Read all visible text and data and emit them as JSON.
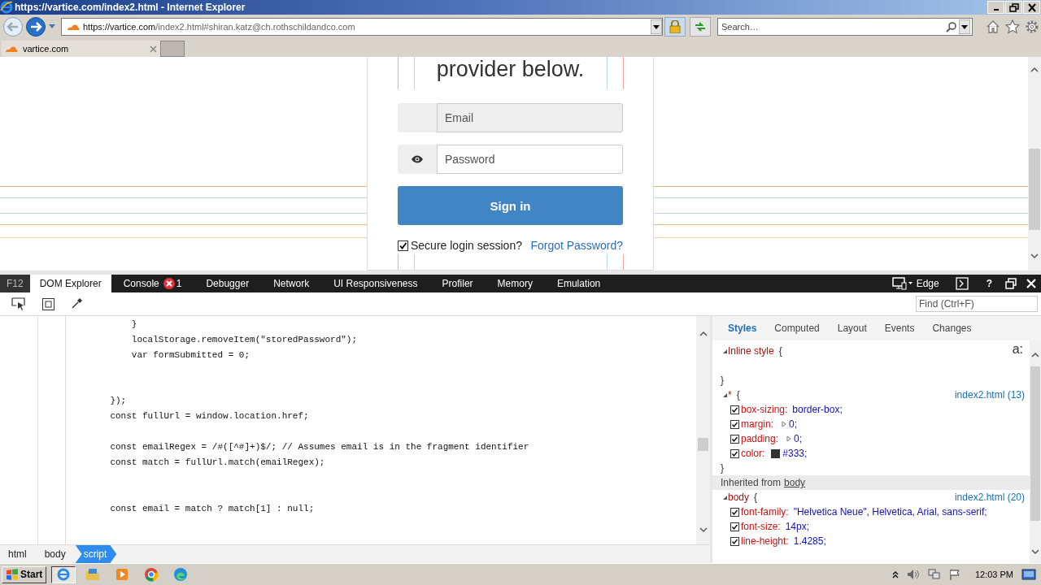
{
  "window": {
    "title": "https://vartice.com/index2.html - Internet Explorer"
  },
  "address_bar": {
    "host": "https://vartice.com",
    "path": "/index2.html#shiran.katz@ch.rothschildandco.com"
  },
  "search": {
    "placeholder": "Search…"
  },
  "tabs": [
    {
      "label": "vartice.com",
      "selected": true
    }
  ],
  "page": {
    "heading": "provider below.",
    "email": {
      "placeholder": "Email"
    },
    "password": {
      "placeholder": "Password"
    },
    "sign_in": "Sign in",
    "secure_session": {
      "label": "Secure login session?",
      "checked": true
    },
    "forgot_link": "Forgot Password?"
  },
  "devtools": {
    "label": "F12",
    "tabs": [
      {
        "label": "DOM Explorer",
        "selected": true
      },
      {
        "label": "Console",
        "selected": false,
        "error_count": "1"
      },
      {
        "label": "Debugger",
        "selected": false
      },
      {
        "label": "Network",
        "selected": false
      },
      {
        "label": "UI Responsiveness",
        "selected": false
      },
      {
        "label": "Profiler",
        "selected": false
      },
      {
        "label": "Memory",
        "selected": false
      },
      {
        "label": "Emulation",
        "selected": false
      }
    ],
    "target": "Edge",
    "help": "?",
    "find": {
      "placeholder": "Find (Ctrl+F)"
    },
    "code_lines": [
      {
        "kind": "code",
        "text": "        }"
      },
      {
        "kind": "code",
        "text": "        localStorage.removeItem(\"storedPassword\");"
      },
      {
        "kind": "code",
        "text": "        var formSubmitted = 0;"
      },
      {
        "kind": "blank"
      },
      {
        "kind": "blank"
      },
      {
        "kind": "code",
        "text": "    });"
      },
      {
        "kind": "code",
        "text": "    const fullUrl = window.location.href;"
      },
      {
        "kind": "blank"
      },
      {
        "kind": "code",
        "text": "    const emailRegex = /#([^#]+)$/; // Assumes email is in the fragment identifier"
      },
      {
        "kind": "code",
        "text": "    const match = fullUrl.match(emailRegex);"
      },
      {
        "kind": "blank"
      },
      {
        "kind": "blank"
      },
      {
        "kind": "code",
        "text": "    const email = match ? match[1] : null;"
      }
    ],
    "breadcrumb": [
      {
        "label": "html",
        "selected": false
      },
      {
        "label": "body",
        "selected": false
      },
      {
        "label": "script",
        "selected": true
      }
    ],
    "styles_tabs": [
      {
        "label": "Styles",
        "selected": true
      },
      {
        "label": "Computed",
        "selected": false
      },
      {
        "label": "Layout",
        "selected": false
      },
      {
        "label": "Events",
        "selected": false
      },
      {
        "label": "Changes",
        "selected": false
      }
    ],
    "state_toggle": "a:",
    "rules": [
      {
        "kind": "rule",
        "selector": "Inline style",
        "open": "{",
        "close": "}",
        "expanded": true
      },
      {
        "kind": "rule",
        "selector": "*",
        "open": "{",
        "close": "}",
        "expanded": true,
        "source": "index2.html (13)",
        "properties": [
          {
            "kind": "plain",
            "name": "box-sizing:",
            "value": "border-box;",
            "checked": true
          },
          {
            "kind": "expandable",
            "name": "margin:",
            "value": "0;",
            "checked": true
          },
          {
            "kind": "expandable",
            "name": "padding:",
            "value": "0;",
            "checked": true
          },
          {
            "kind": "color",
            "name": "color:",
            "value": "#333;",
            "color": "#333333",
            "checked": true
          }
        ]
      },
      {
        "kind": "heading",
        "text": "Inherited from",
        "link": "body"
      },
      {
        "kind": "rule",
        "selector": "body",
        "open": "{",
        "expanded": true,
        "source": "index2.html (20)",
        "properties": [
          {
            "kind": "plain",
            "name": "font-family:",
            "value": "\"Helvetica Neue\", Helvetica, Arial, sans-serif;",
            "checked": true
          },
          {
            "kind": "plain",
            "name": "font-size:",
            "value": "14px;",
            "checked": true
          },
          {
            "kind": "plain",
            "name": "line-height:",
            "value": "1.4285;",
            "checked": true
          }
        ]
      }
    ]
  },
  "taskbar": {
    "start": "Start",
    "clock": "12:03 PM"
  }
}
